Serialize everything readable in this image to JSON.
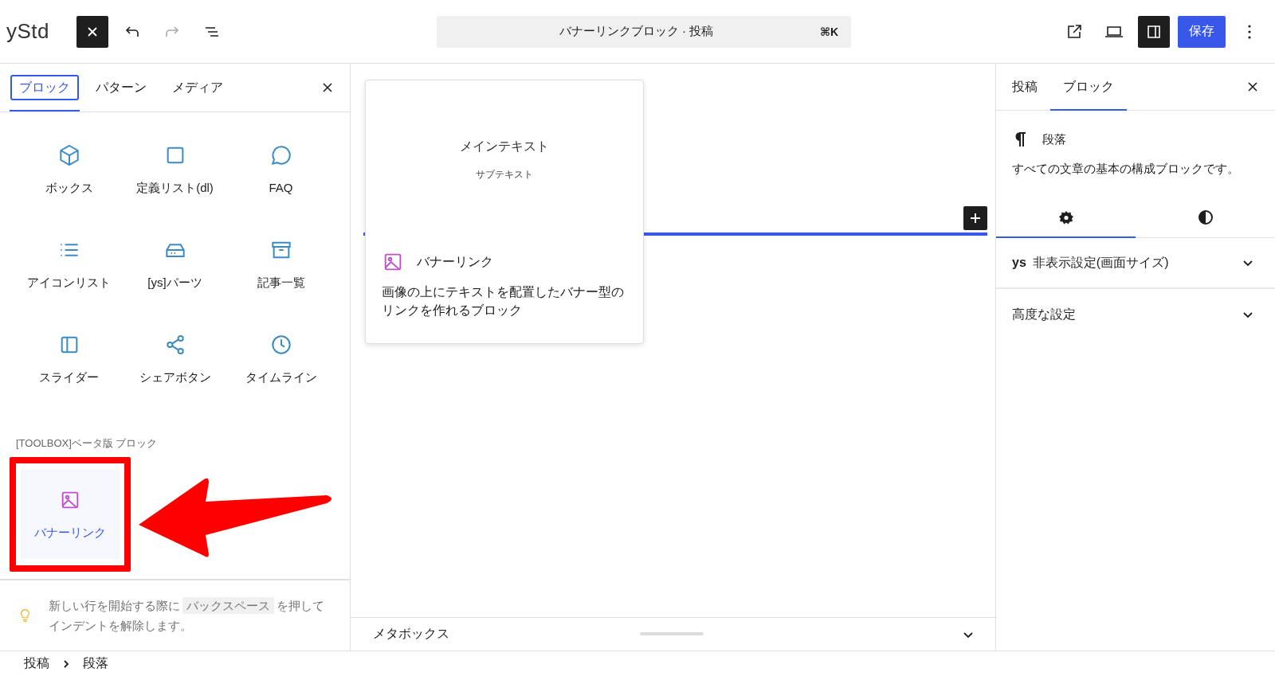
{
  "toolbar": {
    "logo": "yStd",
    "undo": {
      "disabled": false
    },
    "redo": {
      "disabled": true
    },
    "command_bar": {
      "title": "バナーリンクブロック · 投稿",
      "shortcut": "⌘K"
    },
    "sidebar_toggle": {
      "selected": true
    },
    "save_button": "保存"
  },
  "inserter": {
    "tabs": [
      {
        "label": "ブロック",
        "selected": true
      },
      {
        "label": "パターン",
        "selected": false
      },
      {
        "label": "メディア",
        "selected": false
      }
    ],
    "blocks": [
      {
        "label": "ボックス"
      },
      {
        "label": "定義リスト(dl)"
      },
      {
        "label": "FAQ"
      },
      {
        "label": "アイコンリスト"
      },
      {
        "label": "[ys]パーツ"
      },
      {
        "label": "記事一覧"
      },
      {
        "label": "スライダー"
      },
      {
        "label": "シェアボタン"
      },
      {
        "label": "タイムライン"
      }
    ],
    "section_title": "[TOOLBOX]ベータ版 ブロック",
    "beta_blocks": [
      {
        "label": "バナーリンク",
        "highlighted": true
      }
    ],
    "tip": {
      "before": "新しい行を開始する際に",
      "key": "バックスペース",
      "after": "を押してインデントを解除します。"
    }
  },
  "preview": {
    "main_text": "メインテキスト",
    "sub_text": "サブテキスト",
    "title": "バナーリンク",
    "description": "画像の上にテキストを配置したバナー型のリンクを作れるブロック"
  },
  "metabox": {
    "title": "メタボックス",
    "expanded": false
  },
  "settings": {
    "tabs": [
      {
        "label": "投稿",
        "selected": false
      },
      {
        "label": "ブロック",
        "selected": true
      }
    ],
    "block": {
      "title": "段落",
      "description": "すべての文章の基本の構成ブロックです。"
    },
    "subtabs": [
      {
        "selected": true
      },
      {
        "selected": false
      }
    ],
    "panels": [
      {
        "badge": "ys",
        "title": "非表示設定(画面サイズ)",
        "expanded": false
      },
      {
        "title": "高度な設定",
        "expanded": false
      }
    ]
  },
  "breadcrumb": [
    "投稿",
    "段落"
  ]
}
